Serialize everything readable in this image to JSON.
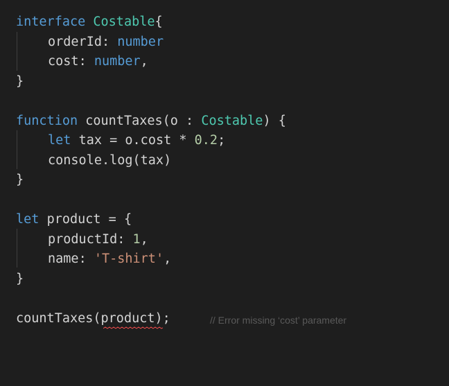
{
  "code": {
    "interface_keyword": "interface",
    "interface_name": "Costable",
    "open_brace": "{",
    "orderId_name": "orderId",
    "orderId_type": "number",
    "cost_name": "cost",
    "cost_type": "number",
    "close_brace": "}",
    "function_keyword": "function",
    "function_name": "countTaxes",
    "param_name": "o",
    "param_type": "Costable",
    "let_keyword": "let",
    "tax_var": "tax",
    "tax_expr": "o.cost",
    "tax_multiplier": "0.2",
    "console_call": "console.log(tax)",
    "product_var": "product",
    "productId_name": "productId",
    "productId_value": "1",
    "name_key": "name",
    "name_value": "'T-shirt'",
    "call_fn": "countTaxes",
    "call_arg": "product"
  },
  "inline_comment": "// Error missing ‘cost’ parameter",
  "colors": {
    "background": "#1e1e1e",
    "keyword": "#569cd6",
    "type": "#4ec9b0",
    "identifier": "#d4d4d4",
    "number": "#b5cea8",
    "string": "#ce9178",
    "error_squiggle": "#f14c4c",
    "comment": "#5a5a5a"
  }
}
